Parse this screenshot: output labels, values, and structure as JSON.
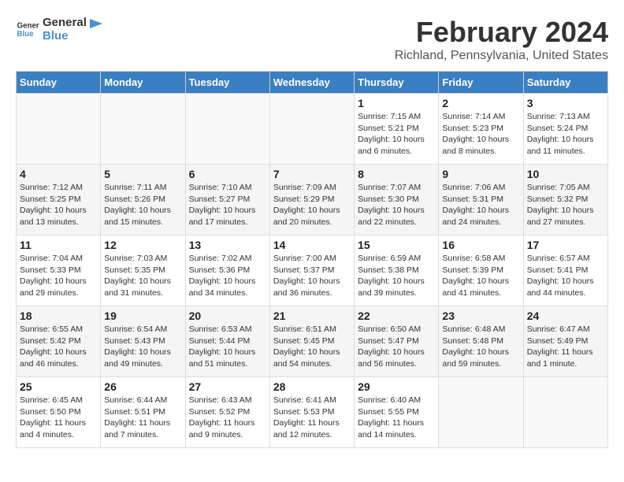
{
  "header": {
    "logo_line1": "General",
    "logo_line2": "Blue",
    "title": "February 2024",
    "subtitle": "Richland, Pennsylvania, United States"
  },
  "days_of_week": [
    "Sunday",
    "Monday",
    "Tuesday",
    "Wednesday",
    "Thursday",
    "Friday",
    "Saturday"
  ],
  "weeks": [
    [
      {
        "day": "",
        "info": ""
      },
      {
        "day": "",
        "info": ""
      },
      {
        "day": "",
        "info": ""
      },
      {
        "day": "",
        "info": ""
      },
      {
        "day": "1",
        "info": "Sunrise: 7:15 AM\nSunset: 5:21 PM\nDaylight: 10 hours\nand 6 minutes."
      },
      {
        "day": "2",
        "info": "Sunrise: 7:14 AM\nSunset: 5:23 PM\nDaylight: 10 hours\nand 8 minutes."
      },
      {
        "day": "3",
        "info": "Sunrise: 7:13 AM\nSunset: 5:24 PM\nDaylight: 10 hours\nand 11 minutes."
      }
    ],
    [
      {
        "day": "4",
        "info": "Sunrise: 7:12 AM\nSunset: 5:25 PM\nDaylight: 10 hours\nand 13 minutes."
      },
      {
        "day": "5",
        "info": "Sunrise: 7:11 AM\nSunset: 5:26 PM\nDaylight: 10 hours\nand 15 minutes."
      },
      {
        "day": "6",
        "info": "Sunrise: 7:10 AM\nSunset: 5:27 PM\nDaylight: 10 hours\nand 17 minutes."
      },
      {
        "day": "7",
        "info": "Sunrise: 7:09 AM\nSunset: 5:29 PM\nDaylight: 10 hours\nand 20 minutes."
      },
      {
        "day": "8",
        "info": "Sunrise: 7:07 AM\nSunset: 5:30 PM\nDaylight: 10 hours\nand 22 minutes."
      },
      {
        "day": "9",
        "info": "Sunrise: 7:06 AM\nSunset: 5:31 PM\nDaylight: 10 hours\nand 24 minutes."
      },
      {
        "day": "10",
        "info": "Sunrise: 7:05 AM\nSunset: 5:32 PM\nDaylight: 10 hours\nand 27 minutes."
      }
    ],
    [
      {
        "day": "11",
        "info": "Sunrise: 7:04 AM\nSunset: 5:33 PM\nDaylight: 10 hours\nand 29 minutes."
      },
      {
        "day": "12",
        "info": "Sunrise: 7:03 AM\nSunset: 5:35 PM\nDaylight: 10 hours\nand 31 minutes."
      },
      {
        "day": "13",
        "info": "Sunrise: 7:02 AM\nSunset: 5:36 PM\nDaylight: 10 hours\nand 34 minutes."
      },
      {
        "day": "14",
        "info": "Sunrise: 7:00 AM\nSunset: 5:37 PM\nDaylight: 10 hours\nand 36 minutes."
      },
      {
        "day": "15",
        "info": "Sunrise: 6:59 AM\nSunset: 5:38 PM\nDaylight: 10 hours\nand 39 minutes."
      },
      {
        "day": "16",
        "info": "Sunrise: 6:58 AM\nSunset: 5:39 PM\nDaylight: 10 hours\nand 41 minutes."
      },
      {
        "day": "17",
        "info": "Sunrise: 6:57 AM\nSunset: 5:41 PM\nDaylight: 10 hours\nand 44 minutes."
      }
    ],
    [
      {
        "day": "18",
        "info": "Sunrise: 6:55 AM\nSunset: 5:42 PM\nDaylight: 10 hours\nand 46 minutes."
      },
      {
        "day": "19",
        "info": "Sunrise: 6:54 AM\nSunset: 5:43 PM\nDaylight: 10 hours\nand 49 minutes."
      },
      {
        "day": "20",
        "info": "Sunrise: 6:53 AM\nSunset: 5:44 PM\nDaylight: 10 hours\nand 51 minutes."
      },
      {
        "day": "21",
        "info": "Sunrise: 6:51 AM\nSunset: 5:45 PM\nDaylight: 10 hours\nand 54 minutes."
      },
      {
        "day": "22",
        "info": "Sunrise: 6:50 AM\nSunset: 5:47 PM\nDaylight: 10 hours\nand 56 minutes."
      },
      {
        "day": "23",
        "info": "Sunrise: 6:48 AM\nSunset: 5:48 PM\nDaylight: 10 hours\nand 59 minutes."
      },
      {
        "day": "24",
        "info": "Sunrise: 6:47 AM\nSunset: 5:49 PM\nDaylight: 11 hours\nand 1 minute."
      }
    ],
    [
      {
        "day": "25",
        "info": "Sunrise: 6:45 AM\nSunset: 5:50 PM\nDaylight: 11 hours\nand 4 minutes."
      },
      {
        "day": "26",
        "info": "Sunrise: 6:44 AM\nSunset: 5:51 PM\nDaylight: 11 hours\nand 7 minutes."
      },
      {
        "day": "27",
        "info": "Sunrise: 6:43 AM\nSunset: 5:52 PM\nDaylight: 11 hours\nand 9 minutes."
      },
      {
        "day": "28",
        "info": "Sunrise: 6:41 AM\nSunset: 5:53 PM\nDaylight: 11 hours\nand 12 minutes."
      },
      {
        "day": "29",
        "info": "Sunrise: 6:40 AM\nSunset: 5:55 PM\nDaylight: 11 hours\nand 14 minutes."
      },
      {
        "day": "",
        "info": ""
      },
      {
        "day": "",
        "info": ""
      }
    ]
  ]
}
